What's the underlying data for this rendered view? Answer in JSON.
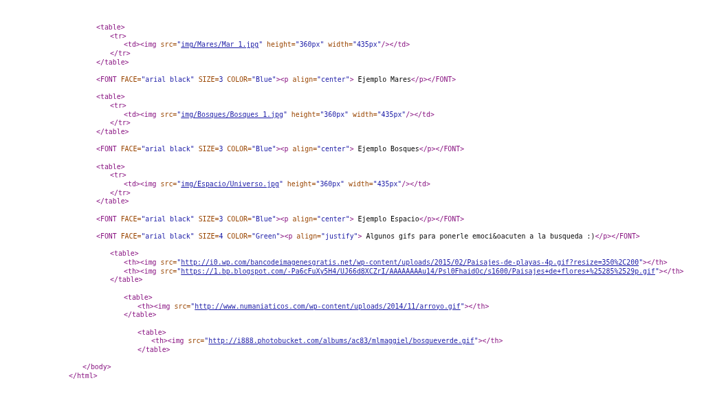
{
  "source_lines": [
    {
      "kind": "block",
      "children": [
        {
          "kind": "block",
          "children": [
            {
              "kind": "code",
              "spans": [
                {
                  "kind": "tag",
                  "text": "<table>"
                }
              ],
              "children": [
                {
                  "kind": "code",
                  "spans": [
                    {
                      "kind": "tag",
                      "text": "<tr>"
                    }
                  ],
                  "children": [
                    {
                      "kind": "code",
                      "spans": [
                        {
                          "kind": "tag",
                          "text": "<td><img"
                        },
                        {
                          "kind": "attr",
                          "text": " src="
                        },
                        {
                          "kind": "value",
                          "text": "\""
                        },
                        {
                          "kind": "link",
                          "text": "img/Mares/Mar 1.jpg"
                        },
                        {
                          "kind": "value",
                          "text": "\""
                        },
                        {
                          "kind": "attr",
                          "text": " height="
                        },
                        {
                          "kind": "value",
                          "text": "\"360px\""
                        },
                        {
                          "kind": "attr",
                          "text": " width="
                        },
                        {
                          "kind": "value",
                          "text": "\"435px\""
                        },
                        {
                          "kind": "tag",
                          "text": "/></td>"
                        }
                      ]
                    }
                  ]
                },
                {
                  "kind": "code",
                  "spans": [
                    {
                      "kind": "tag",
                      "text": "</tr>"
                    }
                  ]
                }
              ]
            },
            {
              "kind": "code",
              "spans": [
                {
                  "kind": "tag",
                  "text": "</table>"
                }
              ]
            },
            {
              "kind": "blank"
            },
            {
              "kind": "code",
              "spans": [
                {
                  "kind": "tag",
                  "text": "<FONT"
                },
                {
                  "kind": "attr",
                  "text": " FACE="
                },
                {
                  "kind": "value",
                  "text": "\"arial black\""
                },
                {
                  "kind": "attr",
                  "text": " SIZE="
                },
                {
                  "kind": "value",
                  "text": "3"
                },
                {
                  "kind": "attr",
                  "text": " COLOR="
                },
                {
                  "kind": "value",
                  "text": "\"Blue\""
                },
                {
                  "kind": "tag",
                  "text": "><p"
                },
                {
                  "kind": "attr",
                  "text": " align="
                },
                {
                  "kind": "value",
                  "text": "\"center\""
                },
                {
                  "kind": "tag",
                  "text": ">"
                },
                {
                  "kind": "text",
                  "text": " Ejemplo Mares"
                },
                {
                  "kind": "tag",
                  "text": "</p></FONT>"
                }
              ]
            },
            {
              "kind": "blank"
            },
            {
              "kind": "code",
              "spans": [
                {
                  "kind": "tag",
                  "text": "<table>"
                }
              ],
              "children": [
                {
                  "kind": "code",
                  "spans": [
                    {
                      "kind": "tag",
                      "text": "<tr>"
                    }
                  ],
                  "children": [
                    {
                      "kind": "code",
                      "spans": [
                        {
                          "kind": "tag",
                          "text": "<td><img"
                        },
                        {
                          "kind": "attr",
                          "text": " src="
                        },
                        {
                          "kind": "value",
                          "text": "\""
                        },
                        {
                          "kind": "link",
                          "text": "img/Bosques/Bosques 1.jpg"
                        },
                        {
                          "kind": "value",
                          "text": "\""
                        },
                        {
                          "kind": "attr",
                          "text": " height="
                        },
                        {
                          "kind": "value",
                          "text": "\"360px\""
                        },
                        {
                          "kind": "attr",
                          "text": " width="
                        },
                        {
                          "kind": "value",
                          "text": "\"435px\""
                        },
                        {
                          "kind": "tag",
                          "text": "/></td>"
                        }
                      ]
                    }
                  ]
                },
                {
                  "kind": "code",
                  "spans": [
                    {
                      "kind": "tag",
                      "text": "</tr>"
                    }
                  ]
                }
              ]
            },
            {
              "kind": "code",
              "spans": [
                {
                  "kind": "tag",
                  "text": "</table>"
                }
              ]
            },
            {
              "kind": "blank"
            },
            {
              "kind": "code",
              "spans": [
                {
                  "kind": "tag",
                  "text": "<FONT"
                },
                {
                  "kind": "attr",
                  "text": " FACE="
                },
                {
                  "kind": "value",
                  "text": "\"arial black\""
                },
                {
                  "kind": "attr",
                  "text": " SIZE="
                },
                {
                  "kind": "value",
                  "text": "3"
                },
                {
                  "kind": "attr",
                  "text": " COLOR="
                },
                {
                  "kind": "value",
                  "text": "\"Blue\""
                },
                {
                  "kind": "tag",
                  "text": "><p"
                },
                {
                  "kind": "attr",
                  "text": " align="
                },
                {
                  "kind": "value",
                  "text": "\"center\""
                },
                {
                  "kind": "tag",
                  "text": ">"
                },
                {
                  "kind": "text",
                  "text": " Ejemplo Bosques"
                },
                {
                  "kind": "tag",
                  "text": "</p></FONT>"
                }
              ]
            },
            {
              "kind": "blank"
            },
            {
              "kind": "code",
              "spans": [
                {
                  "kind": "tag",
                  "text": "<table>"
                }
              ],
              "children": [
                {
                  "kind": "code",
                  "spans": [
                    {
                      "kind": "tag",
                      "text": "<tr>"
                    }
                  ],
                  "children": [
                    {
                      "kind": "code",
                      "spans": [
                        {
                          "kind": "tag",
                          "text": "<td><img"
                        },
                        {
                          "kind": "attr",
                          "text": " src="
                        },
                        {
                          "kind": "value",
                          "text": "\""
                        },
                        {
                          "kind": "link",
                          "text": "img/Espacio/Universo.jpg"
                        },
                        {
                          "kind": "value",
                          "text": "\""
                        },
                        {
                          "kind": "attr",
                          "text": " height="
                        },
                        {
                          "kind": "value",
                          "text": "\"360px\""
                        },
                        {
                          "kind": "attr",
                          "text": " width="
                        },
                        {
                          "kind": "value",
                          "text": "\"435px\""
                        },
                        {
                          "kind": "tag",
                          "text": "/></td>"
                        }
                      ]
                    }
                  ]
                },
                {
                  "kind": "code",
                  "spans": [
                    {
                      "kind": "tag",
                      "text": "</tr>"
                    }
                  ]
                }
              ]
            },
            {
              "kind": "code",
              "spans": [
                {
                  "kind": "tag",
                  "text": "</table>"
                }
              ]
            },
            {
              "kind": "blank"
            },
            {
              "kind": "code",
              "spans": [
                {
                  "kind": "tag",
                  "text": "<FONT"
                },
                {
                  "kind": "attr",
                  "text": " FACE="
                },
                {
                  "kind": "value",
                  "text": "\"arial black\""
                },
                {
                  "kind": "attr",
                  "text": " SIZE="
                },
                {
                  "kind": "value",
                  "text": "3"
                },
                {
                  "kind": "attr",
                  "text": " COLOR="
                },
                {
                  "kind": "value",
                  "text": "\"Blue\""
                },
                {
                  "kind": "tag",
                  "text": "><p"
                },
                {
                  "kind": "attr",
                  "text": " align="
                },
                {
                  "kind": "value",
                  "text": "\"center\""
                },
                {
                  "kind": "tag",
                  "text": ">"
                },
                {
                  "kind": "text",
                  "text": " Ejemplo Espacio"
                },
                {
                  "kind": "tag",
                  "text": "</p></FONT>"
                }
              ]
            },
            {
              "kind": "blank"
            },
            {
              "kind": "code",
              "spans": [
                {
                  "kind": "tag",
                  "text": "<FONT"
                },
                {
                  "kind": "attr",
                  "text": " FACE="
                },
                {
                  "kind": "value",
                  "text": "\"arial black\""
                },
                {
                  "kind": "attr",
                  "text": " SIZE="
                },
                {
                  "kind": "value",
                  "text": "4"
                },
                {
                  "kind": "attr",
                  "text": " COLOR="
                },
                {
                  "kind": "value",
                  "text": "\"Green\""
                },
                {
                  "kind": "tag",
                  "text": "><p"
                },
                {
                  "kind": "attr",
                  "text": " align="
                },
                {
                  "kind": "value",
                  "text": "\"justify\""
                },
                {
                  "kind": "tag",
                  "text": ">"
                },
                {
                  "kind": "text",
                  "text": " Algunos gifs para ponerle emoci&oacuten a la busqueda :)"
                },
                {
                  "kind": "tag",
                  "text": "</p></FONT>"
                }
              ]
            },
            {
              "kind": "blank"
            },
            {
              "kind": "block",
              "children": [
                {
                  "kind": "code",
                  "spans": [
                    {
                      "kind": "tag",
                      "text": "<table>"
                    }
                  ],
                  "children": [
                    {
                      "kind": "code",
                      "spans": [
                        {
                          "kind": "tag",
                          "text": "<th><img"
                        },
                        {
                          "kind": "attr",
                          "text": " src="
                        },
                        {
                          "kind": "value",
                          "text": "\""
                        },
                        {
                          "kind": "link",
                          "text": "http://i0.wp.com/bancodeimagenesgratis.net/wp-content/uploads/2015/02/Paisajes-de-playas-4p.gif?resize=350%2C200"
                        },
                        {
                          "kind": "value",
                          "text": "\""
                        },
                        {
                          "kind": "tag",
                          "text": "></th>"
                        }
                      ]
                    },
                    {
                      "kind": "code",
                      "spans": [
                        {
                          "kind": "tag",
                          "text": "<th><img"
                        },
                        {
                          "kind": "attr",
                          "text": " src="
                        },
                        {
                          "kind": "value",
                          "text": "\""
                        },
                        {
                          "kind": "link",
                          "text": "https://1.bp.blogspot.com/-Pa6cFuXy5H4/UJ66d8XCZrI/AAAAAAAAu14/Psl0FhaidOc/s1600/Paisajes+de+flores+%25285%2529p.gif"
                        },
                        {
                          "kind": "value",
                          "text": "\""
                        },
                        {
                          "kind": "tag",
                          "text": "></th>"
                        }
                      ]
                    }
                  ]
                },
                {
                  "kind": "code",
                  "spans": [
                    {
                      "kind": "tag",
                      "text": "</table>"
                    }
                  ]
                },
                {
                  "kind": "blank"
                },
                {
                  "kind": "block",
                  "children": [
                    {
                      "kind": "code",
                      "spans": [
                        {
                          "kind": "tag",
                          "text": "<table>"
                        }
                      ],
                      "children": [
                        {
                          "kind": "code",
                          "spans": [
                            {
                              "kind": "tag",
                              "text": "<th><img"
                            },
                            {
                              "kind": "attr",
                              "text": " src="
                            },
                            {
                              "kind": "value",
                              "text": "\""
                            },
                            {
                              "kind": "link",
                              "text": "http://www.numaniaticos.com/wp-content/uploads/2014/11/arroyo.gif"
                            },
                            {
                              "kind": "value",
                              "text": "\""
                            },
                            {
                              "kind": "tag",
                              "text": "></th>"
                            }
                          ]
                        }
                      ]
                    },
                    {
                      "kind": "code",
                      "spans": [
                        {
                          "kind": "tag",
                          "text": "</table>"
                        }
                      ]
                    },
                    {
                      "kind": "blank"
                    },
                    {
                      "kind": "block",
                      "children": [
                        {
                          "kind": "code",
                          "spans": [
                            {
                              "kind": "tag",
                              "text": "<table>"
                            }
                          ],
                          "children": [
                            {
                              "kind": "code",
                              "spans": [
                                {
                                  "kind": "tag",
                                  "text": "<th><img"
                                },
                                {
                                  "kind": "attr",
                                  "text": " src="
                                },
                                {
                                  "kind": "value",
                                  "text": "\""
                                },
                                {
                                  "kind": "link",
                                  "text": "http://i888.photobucket.com/albums/ac83/mlmaggiel/bosqueverde.gif"
                                },
                                {
                                  "kind": "value",
                                  "text": "\""
                                },
                                {
                                  "kind": "tag",
                                  "text": "></th>"
                                }
                              ]
                            }
                          ]
                        },
                        {
                          "kind": "code",
                          "spans": [
                            {
                              "kind": "tag",
                              "text": "</table>"
                            }
                          ]
                        }
                      ]
                    }
                  ]
                }
              ]
            },
            {
              "kind": "blank"
            }
          ]
        },
        {
          "kind": "code",
          "spans": [
            {
              "kind": "tag",
              "text": "</body>"
            }
          ]
        }
      ]
    },
    {
      "kind": "code",
      "spans": [
        {
          "kind": "tag",
          "text": "</html>"
        }
      ]
    }
  ]
}
